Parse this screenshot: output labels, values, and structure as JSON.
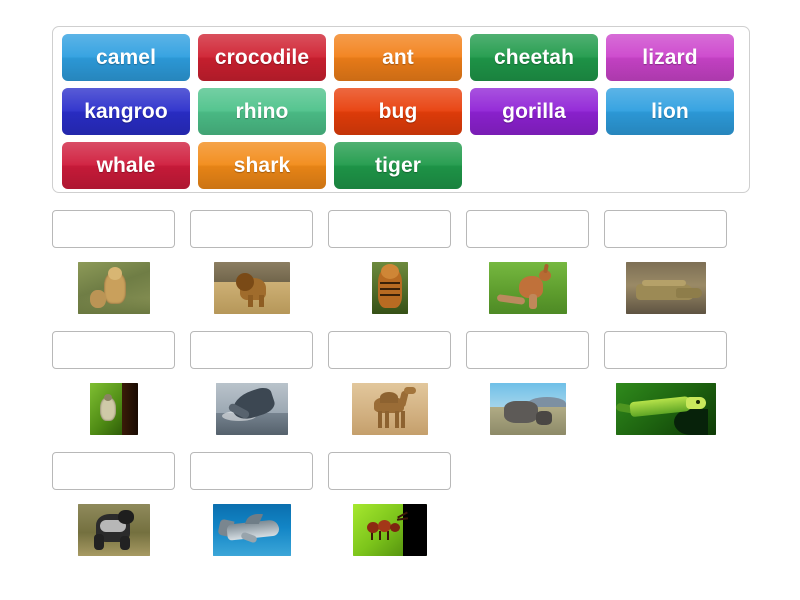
{
  "activity": {
    "type": "match-up",
    "title": "Animal picture match-up"
  },
  "word_bank": {
    "rows": [
      [
        {
          "label": "camel",
          "color": "#2e9fe0"
        },
        {
          "label": "crocodile",
          "color": "#cf2030"
        },
        {
          "label": "ant",
          "color": "#f28019"
        },
        {
          "label": "cheetah",
          "color": "#1f9a4a"
        },
        {
          "label": "lizard",
          "color": "#cc44cc"
        }
      ],
      [
        {
          "label": "kangroo",
          "color": "#2a2ecb"
        },
        {
          "label": "rhino",
          "color": "#4dc28a"
        },
        {
          "label": "bug",
          "color": "#e83e0a"
        },
        {
          "label": "gorilla",
          "color": "#9022d6"
        },
        {
          "label": "lion",
          "color": "#2e9fe0"
        }
      ],
      [
        {
          "label": "whale",
          "color": "#cf1b3b"
        },
        {
          "label": "shark",
          "color": "#f28a17"
        },
        {
          "label": "tiger",
          "color": "#1f9a4a"
        }
      ]
    ]
  },
  "answer_rows": [
    [
      {
        "answer_value": "",
        "placeholder": "",
        "image": "cheetah",
        "image_alt": "cheetah sitting in tall grass"
      },
      {
        "answer_value": "",
        "placeholder": "",
        "image": "lion",
        "image_alt": "lion standing on savanna"
      },
      {
        "answer_value": "",
        "placeholder": "",
        "image": "tiger",
        "image_alt": "tiger facing forward in foliage"
      },
      {
        "answer_value": "",
        "placeholder": "",
        "image": "kangaroo",
        "image_alt": "kangaroo on green grass"
      },
      {
        "answer_value": "",
        "placeholder": "",
        "image": "crocodile",
        "image_alt": "crocodile on riverbank"
      }
    ],
    [
      {
        "answer_value": "",
        "placeholder": "",
        "image": "bug",
        "image_alt": "shield bug on a green leaf"
      },
      {
        "answer_value": "",
        "placeholder": "",
        "image": "whale",
        "image_alt": "humpback whale breaching the sea"
      },
      {
        "answer_value": "",
        "placeholder": "",
        "image": "camel",
        "image_alt": "camel walking in desert sand"
      },
      {
        "answer_value": "",
        "placeholder": "",
        "image": "rhino",
        "image_alt": "rhino and calf under blue sky"
      },
      {
        "answer_value": "",
        "placeholder": "",
        "image": "lizard",
        "image_alt": "green lizard on a leaf"
      }
    ],
    [
      {
        "answer_value": "",
        "placeholder": "",
        "image": "gorilla",
        "image_alt": "silverback gorilla standing"
      },
      {
        "answer_value": "",
        "placeholder": "",
        "image": "shark",
        "image_alt": "shark swimming underwater"
      },
      {
        "answer_value": "",
        "placeholder": "",
        "image": "ant",
        "image_alt": "red ant on a bright green leaf"
      }
    ]
  ]
}
